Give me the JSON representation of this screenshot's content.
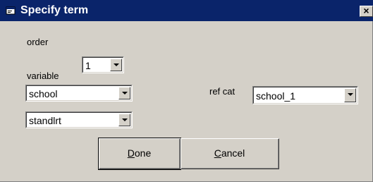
{
  "window": {
    "title": "Specify term",
    "close_glyph": "×",
    "title_icon": "window-icon"
  },
  "order": {
    "label": "order",
    "value": "1"
  },
  "variable": {
    "label": "variable",
    "first_value": "school",
    "second_value": "standlrt"
  },
  "ref_cat": {
    "label": "ref cat",
    "value": "school_1"
  },
  "buttons": {
    "done": {
      "label": "Done",
      "mnemonic": "D",
      "rest": "one"
    },
    "cancel": {
      "label": "Cancel",
      "mnemonic": "C",
      "rest": "ancel"
    }
  },
  "colors": {
    "titlebar": "#0a246a",
    "dialog_face": "#d4d0c8"
  }
}
